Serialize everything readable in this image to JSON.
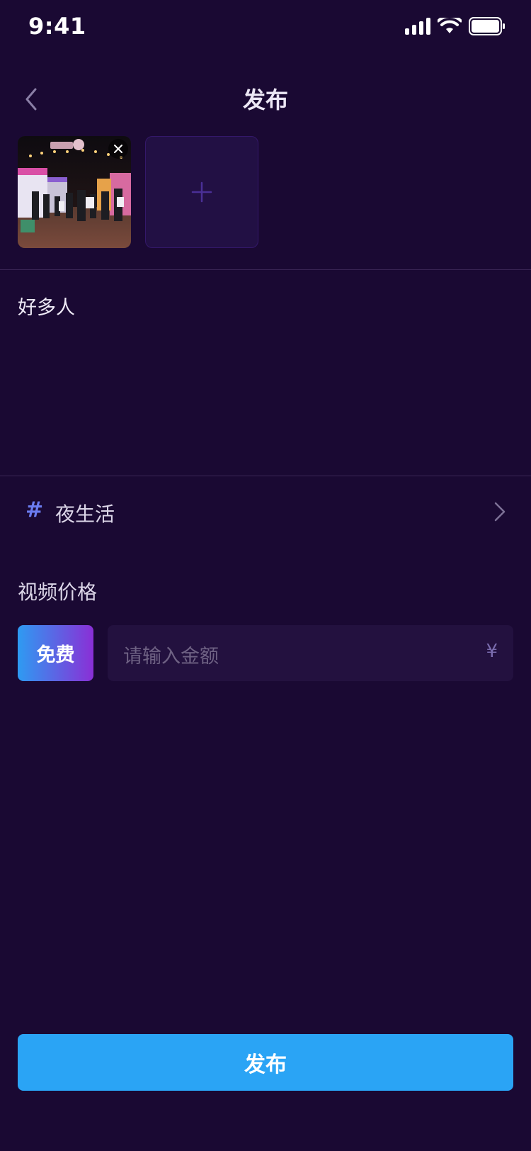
{
  "status": {
    "time": "9:41"
  },
  "header": {
    "title": "发布"
  },
  "media": {
    "items": [
      {
        "kind": "photo",
        "subject": "night street market"
      }
    ],
    "add_icon": "plus-icon",
    "remove_icon": "close-icon"
  },
  "post": {
    "text": "好多人"
  },
  "topic": {
    "hash": "#",
    "label": "夜生活"
  },
  "price": {
    "section_title": "视频价格",
    "free_label": "免费",
    "amount_placeholder": "请输入金额",
    "currency_symbol": "¥"
  },
  "footer": {
    "publish_label": "发布"
  },
  "colors": {
    "background": "#1a0933",
    "accent": "#2aa4f5",
    "free_gradient_start": "#2e9bf2",
    "free_gradient_end": "#8a2fd6",
    "topic_hash": "#6b7cf0"
  }
}
